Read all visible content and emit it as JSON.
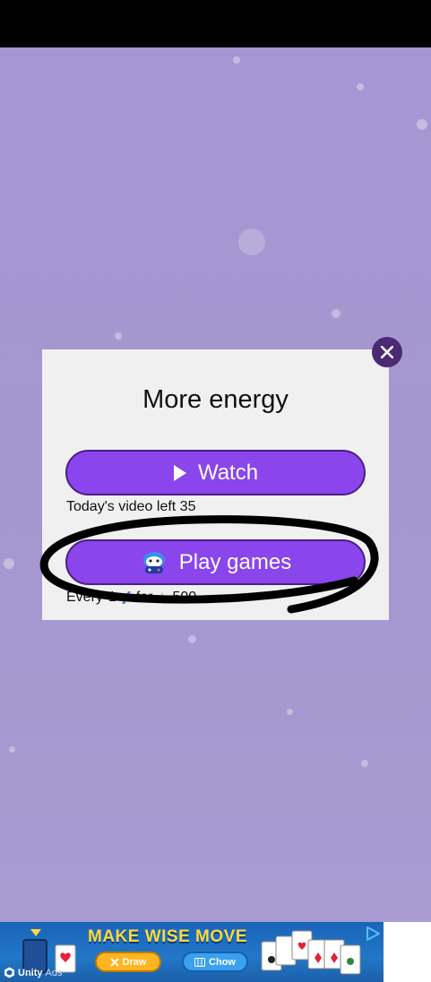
{
  "dialog": {
    "title": "More energy",
    "watch_label": "Watch",
    "video_left_text": "Today's video left 35",
    "play_games_label": "Play games",
    "every_prefix": "Every",
    "every_value": "1",
    "every_for": "for",
    "every_reward": "500"
  },
  "ad": {
    "headline": "MAKE WISE MOVE",
    "draw_label": "Draw",
    "chow_label": "Chow",
    "brand": "Unity",
    "ads_label": "Ads"
  },
  "colors": {
    "background": "#a697d0",
    "button": "#8a45ec",
    "close_button": "#4a2b73",
    "dialog": "#f1f0f1"
  },
  "icons": {
    "watch": "play-triangle-icon",
    "play_games": "gamepad-mascot-icon",
    "close": "close-icon"
  }
}
